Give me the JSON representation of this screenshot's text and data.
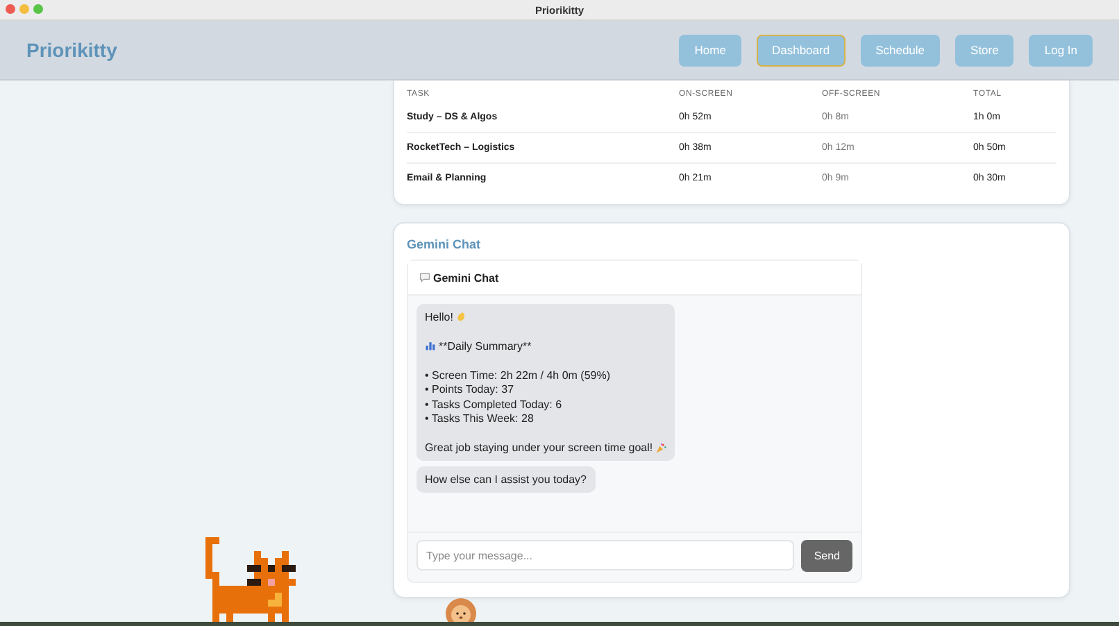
{
  "window": {
    "title": "Priorikitty"
  },
  "header": {
    "brand": "Priorikitty",
    "nav": [
      {
        "label": "Home",
        "selected": false
      },
      {
        "label": "Dashboard",
        "selected": true
      },
      {
        "label": "Schedule",
        "selected": false
      },
      {
        "label": "Store",
        "selected": false
      },
      {
        "label": "Log In",
        "selected": false
      }
    ]
  },
  "task_table": {
    "columns": [
      "TASK",
      "ON-SCREEN",
      "OFF-SCREEN",
      "TOTAL"
    ],
    "rows": [
      [
        "Study – DS & Algos",
        "0h 52m",
        "0h 8m",
        "1h 0m"
      ],
      [
        "RocketTech – Logistics",
        "0h 38m",
        "0h 12m",
        "0h 50m"
      ],
      [
        "Email & Planning",
        "0h 21m",
        "0h 9m",
        "0h 30m"
      ]
    ]
  },
  "chat_section": {
    "title": "Gemini Chat",
    "chat_title": "Gemini Chat",
    "messages": [
      {
        "paragraphs": [
          {
            "kind": "greeting",
            "lines": [
              "Hello!"
            ]
          },
          {
            "kind": "summary",
            "lines": [
              "**Daily Summary**"
            ]
          },
          {
            "kind": "bullets",
            "lines": [
              "• Screen Time: 2h 22m / 4h 0m (59%)",
              "• Points Today: 37",
              "• Tasks Completed Today: 6",
              "• Tasks This Week: 28"
            ]
          },
          {
            "kind": "closing",
            "lines": [
              "Great job staying under your screen time goal!"
            ]
          }
        ]
      },
      {
        "paragraphs": [
          {
            "kind": "plain",
            "lines": [
              "How else can I assist you today?"
            ]
          }
        ]
      }
    ],
    "input": {
      "placeholder": "Type your message..."
    },
    "send_button": "Send"
  }
}
